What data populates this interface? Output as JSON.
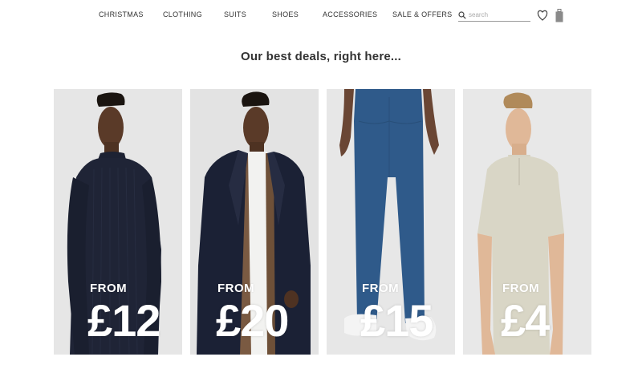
{
  "nav": {
    "items": [
      {
        "label": "CHRISTMAS"
      },
      {
        "label": "CLOTHING"
      },
      {
        "label": "SUITS"
      },
      {
        "label": "SHOES"
      },
      {
        "label": "ACCESSORIES"
      },
      {
        "label": "SALE & OFFERS"
      }
    ],
    "search": {
      "placeholder": "search",
      "icon": "search-icon"
    },
    "wishlist_icon": "heart-icon",
    "bag_icon": "shopping-bag-icon"
  },
  "headline": "Our best deals, right here...",
  "deals": [
    {
      "from_label": "FROM",
      "price": "£12",
      "product": "knit-jumper"
    },
    {
      "from_label": "FROM",
      "price": "£20",
      "product": "overcoat"
    },
    {
      "from_label": "FROM",
      "price": "£15",
      "product": "jeans"
    },
    {
      "from_label": "FROM",
      "price": "£4",
      "product": "polo-shirt"
    }
  ],
  "colors": {
    "card_bg": "#e4e4e4",
    "price_text": "#ffffff",
    "nav_text": "#333333"
  }
}
